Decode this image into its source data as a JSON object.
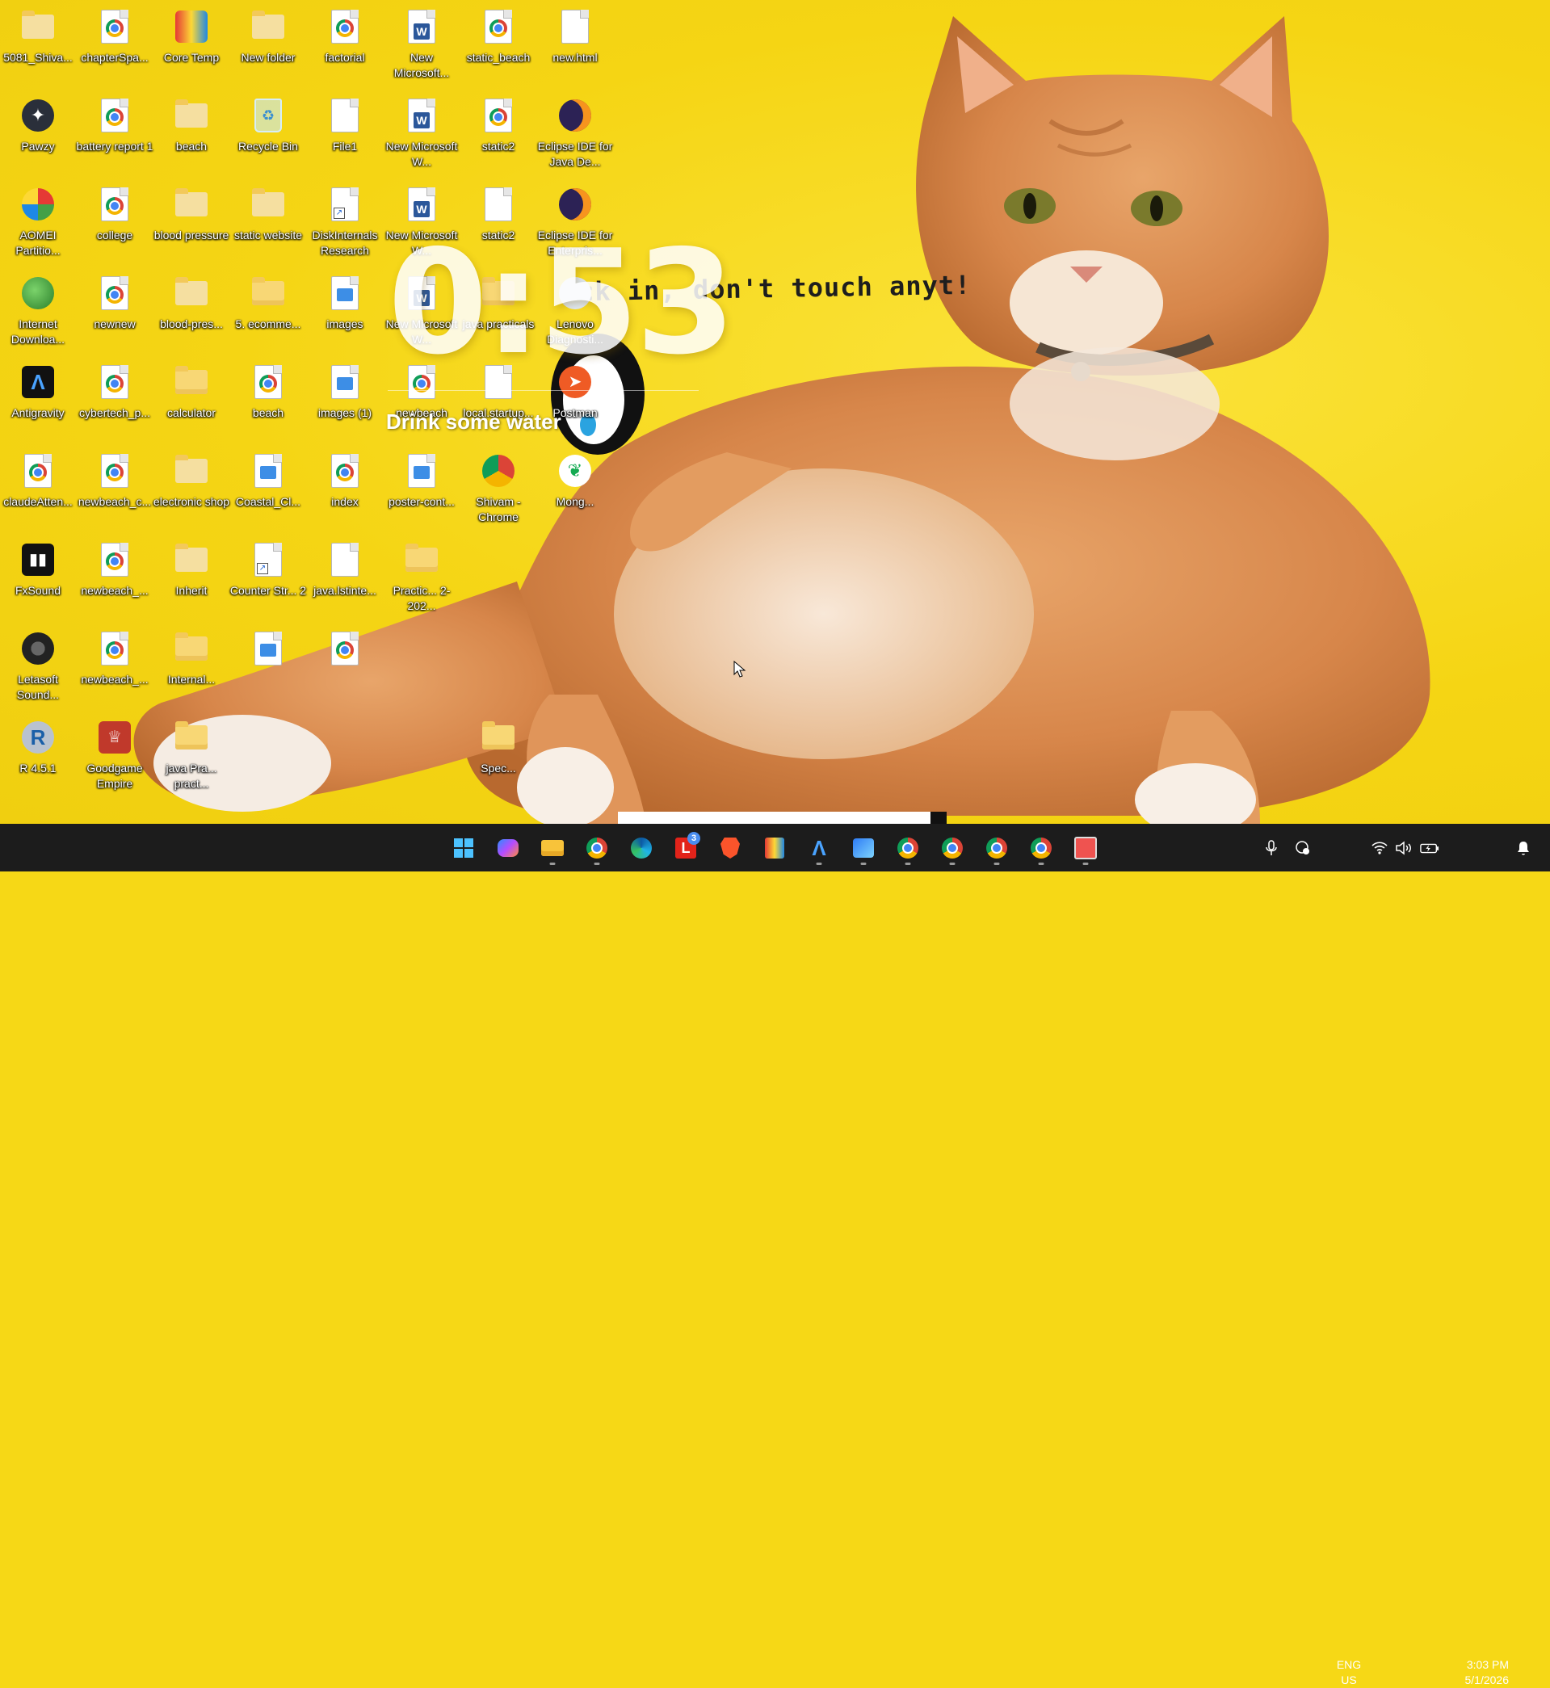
{
  "desktop": {
    "icons": [
      {
        "label": "5081_Shiva...",
        "kind": "folder-empty",
        "col": 0,
        "row": 0
      },
      {
        "label": "chapterSpa...",
        "kind": "chrome",
        "col": 1,
        "row": 0
      },
      {
        "label": "Core Temp",
        "kind": "app-coretemp",
        "col": 2,
        "row": 0
      },
      {
        "label": "New folder",
        "kind": "folder-empty",
        "col": 3,
        "row": 0
      },
      {
        "label": "factorial",
        "kind": "chrome",
        "col": 4,
        "row": 0
      },
      {
        "label": "New Microsoft...",
        "kind": "word",
        "col": 5,
        "row": 0
      },
      {
        "label": "static_beach",
        "kind": "chrome",
        "col": 6,
        "row": 0
      },
      {
        "label": "new.html",
        "kind": "page",
        "col": 7,
        "row": 0
      },
      {
        "label": "Pawzy",
        "kind": "app-pawzy",
        "col": 0,
        "row": 1
      },
      {
        "label": "battery report 1",
        "kind": "chrome",
        "col": 1,
        "row": 1
      },
      {
        "label": "beach",
        "kind": "folder-empty",
        "col": 2,
        "row": 1
      },
      {
        "label": "Recycle Bin",
        "kind": "recycle",
        "col": 3,
        "row": 1
      },
      {
        "label": "File1",
        "kind": "page",
        "col": 4,
        "row": 1
      },
      {
        "label": "New Microsoft W...",
        "kind": "word",
        "col": 5,
        "row": 1
      },
      {
        "label": "static2",
        "kind": "chrome",
        "col": 6,
        "row": 1
      },
      {
        "label": "Eclipse IDE for Java De...",
        "kind": "eclipse",
        "col": 7,
        "row": 1
      },
      {
        "label": "AOMEI Partitio...",
        "kind": "app-aomei",
        "col": 0,
        "row": 2
      },
      {
        "label": "college",
        "kind": "chrome",
        "col": 1,
        "row": 2
      },
      {
        "label": "blood pressure",
        "kind": "folder-empty",
        "col": 2,
        "row": 2
      },
      {
        "label": "static website",
        "kind": "folder-empty",
        "col": 3,
        "row": 2
      },
      {
        "label": "DiskInternals Research",
        "kind": "page-shortcut",
        "col": 4,
        "row": 2
      },
      {
        "label": "New Microsoft W...",
        "kind": "word",
        "col": 5,
        "row": 2
      },
      {
        "label": "static2",
        "kind": "page",
        "col": 6,
        "row": 2
      },
      {
        "label": "Eclipse IDE for Enterpris...",
        "kind": "eclipse",
        "col": 7,
        "row": 2
      },
      {
        "label": "Internet Downloa...",
        "kind": "app-idm",
        "col": 0,
        "row": 3
      },
      {
        "label": "newnew",
        "kind": "chrome",
        "col": 1,
        "row": 3
      },
      {
        "label": "blood-pres...",
        "kind": "folder-empty",
        "col": 2,
        "row": 3
      },
      {
        "label": "5. ecomme...",
        "kind": "folder",
        "col": 3,
        "row": 3
      },
      {
        "label": "images",
        "kind": "image",
        "col": 4,
        "row": 3
      },
      {
        "label": "New Microsoft W...",
        "kind": "word",
        "col": 5,
        "row": 3
      },
      {
        "label": "java practicals",
        "kind": "folder",
        "col": 6,
        "row": 3
      },
      {
        "label": "Lenovo Diagnosti...",
        "kind": "app-lenovo",
        "col": 7,
        "row": 3
      },
      {
        "label": "Antigravity",
        "kind": "app-antigravity",
        "col": 0,
        "row": 4
      },
      {
        "label": "cybertech_p...",
        "kind": "chrome",
        "col": 1,
        "row": 4
      },
      {
        "label": "calculator",
        "kind": "folder",
        "col": 2,
        "row": 4
      },
      {
        "label": "beach",
        "kind": "chrome",
        "col": 3,
        "row": 4
      },
      {
        "label": "images (1)",
        "kind": "image",
        "col": 4,
        "row": 4
      },
      {
        "label": "newbeach",
        "kind": "chrome",
        "col": 5,
        "row": 4
      },
      {
        "label": "local.startup...",
        "kind": "page",
        "col": 6,
        "row": 4
      },
      {
        "label": "Postman",
        "kind": "app-postman",
        "col": 7,
        "row": 4
      },
      {
        "label": "claudeAtten...",
        "kind": "chrome",
        "col": 0,
        "row": 5
      },
      {
        "label": "newbeach_c...",
        "kind": "chrome",
        "col": 1,
        "row": 5
      },
      {
        "label": "electronic shop",
        "kind": "folder-empty",
        "col": 2,
        "row": 5
      },
      {
        "label": "Coastal_Cl...",
        "kind": "image",
        "col": 3,
        "row": 5
      },
      {
        "label": "index",
        "kind": "chrome",
        "col": 4,
        "row": 5
      },
      {
        "label": "poster-cont...",
        "kind": "image",
        "col": 5,
        "row": 5
      },
      {
        "label": "Shivam - Chrome",
        "kind": "app-chrome-profile",
        "col": 6,
        "row": 5
      },
      {
        "label": "Mong...",
        "kind": "app-mongo",
        "col": 7,
        "row": 5
      },
      {
        "label": "FxSound",
        "kind": "app-fxsound",
        "col": 0,
        "row": 6
      },
      {
        "label": "newbeach_...",
        "kind": "chrome",
        "col": 1,
        "row": 6
      },
      {
        "label": "Inherit",
        "kind": "folder-empty",
        "col": 2,
        "row": 6
      },
      {
        "label": "Counter Str... 2",
        "kind": "page-shortcut",
        "col": 3,
        "row": 6
      },
      {
        "label": "java.lstinte...",
        "kind": "page",
        "col": 4,
        "row": 6
      },
      {
        "label": "Practic... 2-202...",
        "kind": "folder",
        "col": 5,
        "row": 6
      },
      {
        "label": "Letasoft Sound...",
        "kind": "app-letasoft",
        "col": 0,
        "row": 7
      },
      {
        "label": "newbeach_...",
        "kind": "chrome",
        "col": 1,
        "row": 7
      },
      {
        "label": "Internal...",
        "kind": "folder",
        "col": 2,
        "row": 7
      },
      {
        "label": "",
        "kind": "image",
        "col": 3,
        "row": 7
      },
      {
        "label": "",
        "kind": "chrome",
        "col": 4,
        "row": 7
      },
      {
        "label": "R 4.5.1",
        "kind": "app-r",
        "col": 0,
        "row": 8
      },
      {
        "label": "Goodgame Empire",
        "kind": "app-goodgame",
        "col": 1,
        "row": 8
      },
      {
        "label": "java Pra... pract...",
        "kind": "folder",
        "col": 2,
        "row": 8
      },
      {
        "label": "Spec...",
        "kind": "folder",
        "col": 6,
        "row": 8
      }
    ]
  },
  "widget": {
    "timer": "0:53",
    "reminder": "Drink some water"
  },
  "wallpaper": {
    "caption": "ck in, don't touch anyt!"
  },
  "taskbar": {
    "apps": [
      {
        "name": "start",
        "icon": "windows-icon"
      },
      {
        "name": "copilot",
        "icon": "copilot-icon"
      },
      {
        "name": "file-explorer",
        "icon": "folder-icon",
        "open": true
      },
      {
        "name": "chrome-profile",
        "icon": "chrome-icon",
        "open": true
      },
      {
        "name": "edge",
        "icon": "edge-icon"
      },
      {
        "name": "lenovo",
        "icon": "lenovo-icon",
        "badge": "3"
      },
      {
        "name": "brave",
        "icon": "brave-icon"
      },
      {
        "name": "core-temp",
        "icon": "coretemp-icon"
      },
      {
        "name": "antigravity",
        "icon": "antigravity-icon",
        "open": true
      },
      {
        "name": "photos",
        "icon": "photos-icon",
        "open": true
      },
      {
        "name": "chrome",
        "icon": "chrome-icon",
        "open": true
      },
      {
        "name": "chrome-2",
        "icon": "chrome-icon",
        "open": true
      },
      {
        "name": "chrome-3",
        "icon": "chrome-icon",
        "open": true
      },
      {
        "name": "chrome-4",
        "icon": "chrome-icon",
        "open": true
      },
      {
        "name": "snipping-tool",
        "icon": "snip-icon",
        "open": true
      }
    ],
    "tray": {
      "lang_top": "ENG",
      "lang_bottom": "US",
      "time": "3:03 PM",
      "date": "5/1/2026"
    }
  },
  "colors": {
    "wallpaper": "#f6d816",
    "taskbar": "#1c1c1c",
    "cat_fur": "#d9864a",
    "cat_light": "#f4e2cc"
  }
}
